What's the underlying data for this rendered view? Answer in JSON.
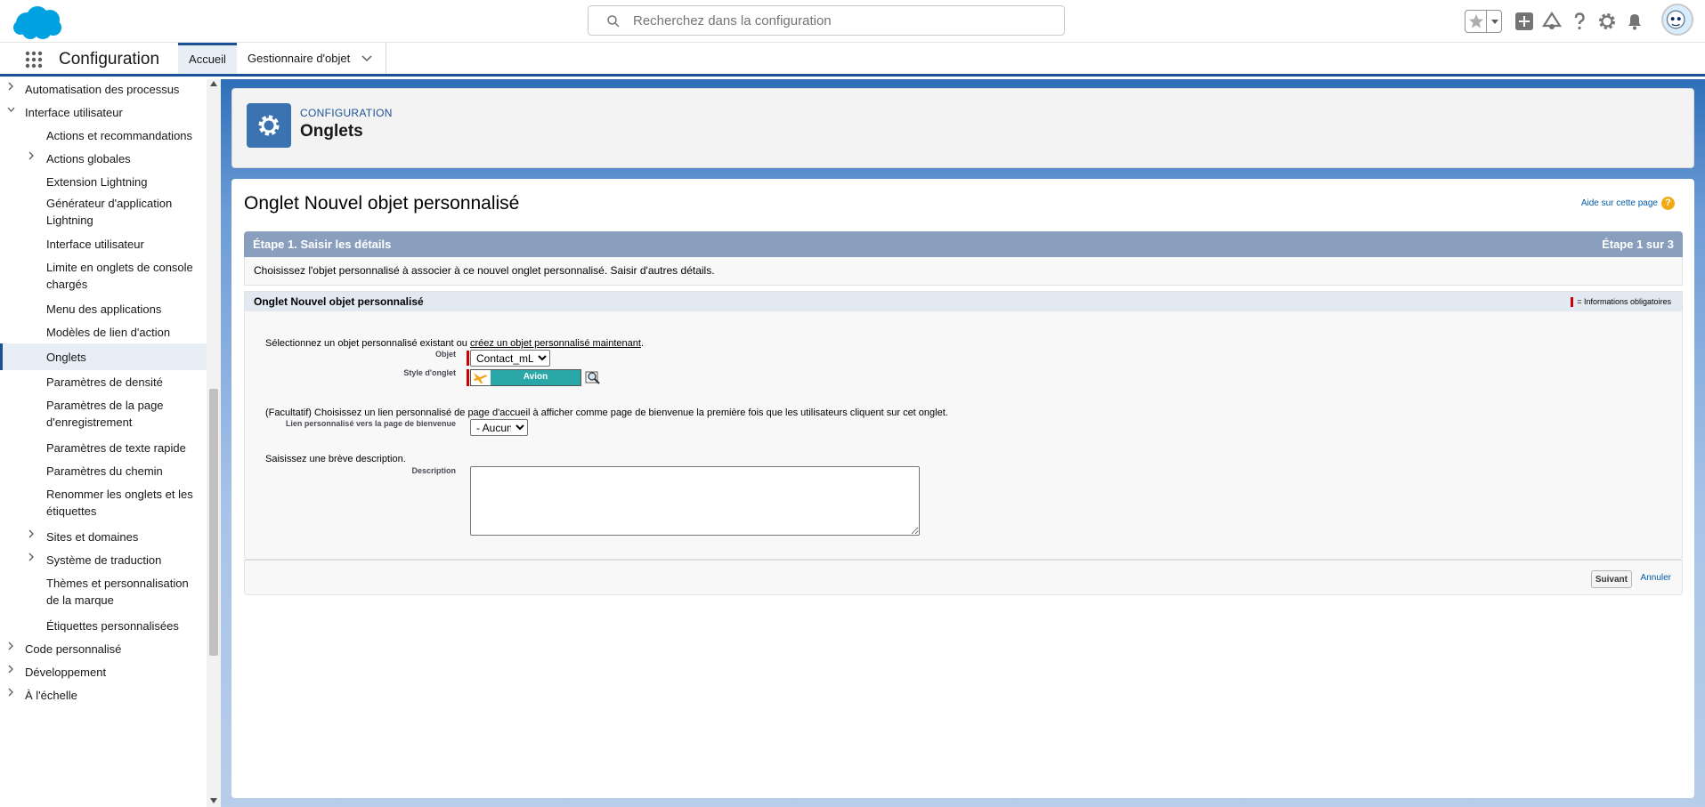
{
  "colors": {
    "brand": "#1b5297",
    "cloud": "#00a1e0",
    "link": "#015ba7",
    "required": "#c00000",
    "step_header": "#8a9ebe"
  },
  "topbar": {
    "search_placeholder": "Recherchez dans la configuration",
    "icons": [
      "salesforce-logo",
      "search-icon",
      "favorites-star-icon",
      "add-icon",
      "trailhead-icon",
      "help-icon",
      "setup-gear-icon",
      "notifications-bell-icon",
      "user-avatar"
    ]
  },
  "nav": {
    "app_title": "Configuration",
    "tabs": [
      {
        "label": "Accueil",
        "active": true
      },
      {
        "label": "Gestionnaire d'objet",
        "has_menu": true
      }
    ]
  },
  "sidebar": {
    "items": [
      {
        "label": "Automatisation des processus",
        "level": 1,
        "expandable": true
      },
      {
        "label": "Interface utilisateur",
        "level": 1,
        "expanded": true
      },
      {
        "label": "Actions et recommandations",
        "level": 2
      },
      {
        "label": "Actions globales",
        "level": 2,
        "expandable": true
      },
      {
        "label": "Extension Lightning",
        "level": 2
      },
      {
        "label": "Générateur d'application Lightning",
        "level": 2
      },
      {
        "label": "Interface utilisateur",
        "level": 2
      },
      {
        "label": "Limite en onglets de console chargés",
        "level": 2
      },
      {
        "label": "Menu des applications",
        "level": 2
      },
      {
        "label": "Modèles de lien d'action",
        "level": 2
      },
      {
        "label": "Onglets",
        "level": 2,
        "active": true
      },
      {
        "label": "Paramètres de densité",
        "level": 2
      },
      {
        "label": "Paramètres de la page d'enregistrement",
        "level": 2
      },
      {
        "label": "Paramètres de texte rapide",
        "level": 2
      },
      {
        "label": "Paramètres du chemin",
        "level": 2
      },
      {
        "label": "Renommer les onglets et les étiquettes",
        "level": 2
      },
      {
        "label": "Sites et domaines",
        "level": 2,
        "expandable": true
      },
      {
        "label": "Système de traduction",
        "level": 2,
        "expandable": true
      },
      {
        "label": "Thèmes et personnalisation de la marque",
        "level": 2
      },
      {
        "label": "Étiquettes personnalisées",
        "level": 2
      },
      {
        "label": "Code personnalisé",
        "level": 1,
        "expandable": true
      },
      {
        "label": "Développement",
        "level": 1,
        "expandable": true
      },
      {
        "label": "À l'échelle",
        "level": 1,
        "expandable": true
      }
    ]
  },
  "header": {
    "kicker": "CONFIGURATION",
    "title": "Onglets"
  },
  "page": {
    "title": "Onglet Nouvel objet personnalisé",
    "help_link": "Aide sur cette page",
    "step_label": "Étape 1. Saisir les détails",
    "step_count": "Étape 1 sur 3",
    "step_description": "Choisissez l'objet personnalisé à associer à ce nouvel onglet personnalisé. Saisir d'autres détails.",
    "section_title": "Onglet Nouvel objet personnalisé",
    "required_legend": "= Informations obligatoires",
    "select_intro": "Sélectionnez un objet personnalisé existant ou",
    "create_link": "créez un objet personnalisé maintenant",
    "create_link_suffix": ".",
    "object_label": "Objet",
    "object_value": "Contact_mList",
    "tab_style_label": "Style d'onglet",
    "tab_style_value": "Avion",
    "splash_intro": "(Facultatif) Choisissez un lien personnalisé de page d'accueil à afficher comme page de bienvenue la première fois que les utilisateurs cliquent sur cet onglet.",
    "splash_label": "Lien personnalisé vers la page de bienvenue",
    "splash_value": "- Aucun -",
    "desc_intro": "Saisissez une brève description.",
    "desc_label": "Description",
    "desc_value": "",
    "next_button": "Suivant",
    "cancel_link": "Annuler"
  }
}
